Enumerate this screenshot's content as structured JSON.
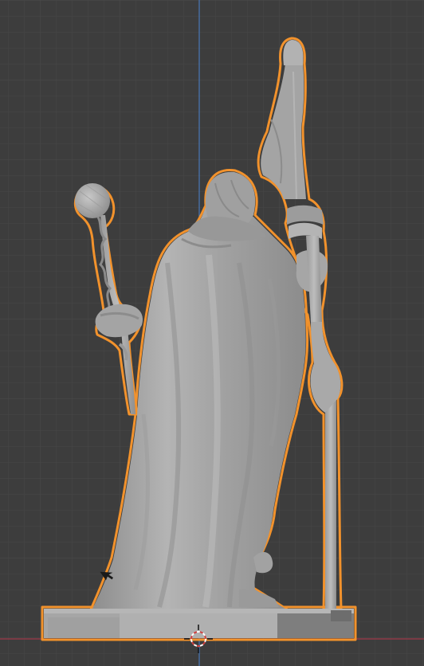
{
  "app": "3D viewport",
  "viewport": {
    "view": "front-orthographic",
    "background_color": "#3d3d3d",
    "grid": true,
    "grid_minor_color": "#454545",
    "grid_major_color": "#4a4a4a",
    "axis_z_color": "#4a78b8",
    "axis_x_color": "#a03a48"
  },
  "object": {
    "name_icon": "wizard-statue-mesh",
    "selected": true,
    "selection_outline_color": "#f2922c",
    "mesh_color": "#a8a8a8"
  },
  "cursor_3d": {
    "icon": "3d-cursor-icon",
    "colors": [
      "#ffffff",
      "#d04040"
    ]
  },
  "mouse_pointer": {
    "icon": "arrow-cursor-icon"
  }
}
